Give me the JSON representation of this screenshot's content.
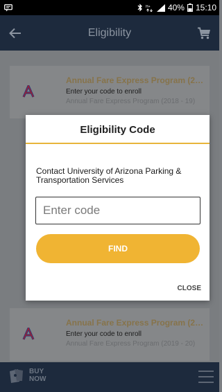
{
  "status_bar": {
    "battery": "40%",
    "time": "15:10",
    "icons": [
      "chat-icon",
      "bluetooth-icon",
      "data-icon",
      "signal-icon",
      "battery-icon"
    ]
  },
  "header": {
    "title": "Eligibility",
    "back_icon": "arrow-left-icon",
    "cart_icon": "cart-icon"
  },
  "cards": [
    {
      "title": "Annual Fare Express Program (2018 - 19)",
      "subtitle": "Enter your code to enroll",
      "meta": "Annual Fare Express Program (2018 - 19)",
      "logo": "university-logo-icon"
    },
    {
      "title": "Annual Fare Express Program (2019 - 20)",
      "subtitle": "Enter your code to enroll",
      "meta": "Annual Fare Express Program (2019 - 20)",
      "logo": "university-logo-icon"
    }
  ],
  "modal": {
    "title": "Eligibility Code",
    "message": "Contact University of Arizona Parking & Transportation Services",
    "input_placeholder": "Enter code",
    "input_value": "",
    "find_label": "FIND",
    "close_label": "CLOSE"
  },
  "bottom_bar": {
    "buy_now_label": "BUY NOW",
    "menu_icon": "hamburger-menu-icon"
  },
  "colors": {
    "accent": "#f0b433",
    "header_bg": "#1d2a3d",
    "overlay": "#7a7d80"
  }
}
